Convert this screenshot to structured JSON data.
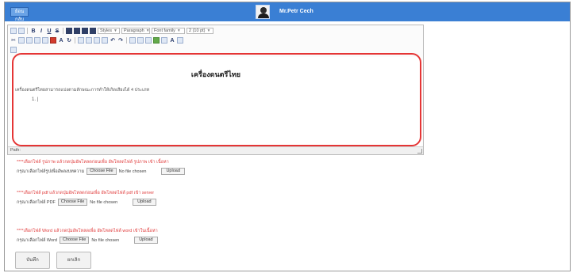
{
  "header": {
    "back_label": "ย้อนกลับ",
    "username": "Mr.Petr Cech",
    "bg_color": "#3a7fd4"
  },
  "toolbar": {
    "styles": "Styles",
    "paragraph": "Paragraph",
    "font_family": "Font family",
    "font_size": "2 (10 pt)"
  },
  "editor": {
    "title": "เครื่องดนตรีไทย",
    "paragraph": "เครื่องดนตรีไทยสามารถแบ่งตามลักษณะการทำให้เกิดเสียงได้ 4 ประเภท",
    "list_item": "1. |",
    "path_label": "Path:"
  },
  "uploads": [
    {
      "note": "****เลือกไฟล์ รูปภาพ แล้วกดปุ่มอัพโหลดก่อนเพื่อ อัพโหลดไฟล์ รูปภาพ เข้า เนื้อหา",
      "label": "กรุณาเลือกไฟล์รูปเพื่ออัพลงบทความ",
      "choose": "Choose File",
      "status": "No file chosen",
      "upload": "Upload"
    },
    {
      "note": "****เลือกไฟล์ pdf แล้วกดปุ่มอัพโหลดก่อนเพื่อ อัพโหลดไฟล์ pdf เข้า server",
      "label": "กรุณาเลือกไฟล์ PDF",
      "choose": "Choose File",
      "status": "No file chosen",
      "upload": "Upload"
    },
    {
      "note": "****เลือกไฟล์ Word แล้วกดปุ่มอัพโหลดเพื่อ อัพโหลดไฟล์ word เข้าในเนื้อหา",
      "label": "กรุณาเลือกไฟล์ Word",
      "choose": "Choose File",
      "status": "No file chosen",
      "upload": "Upload"
    }
  ],
  "buttons": {
    "save": "บันทึก",
    "cancel": "ยกเลิก"
  },
  "colors": {
    "highlight": "#e53535",
    "note_red": "#e14040"
  }
}
